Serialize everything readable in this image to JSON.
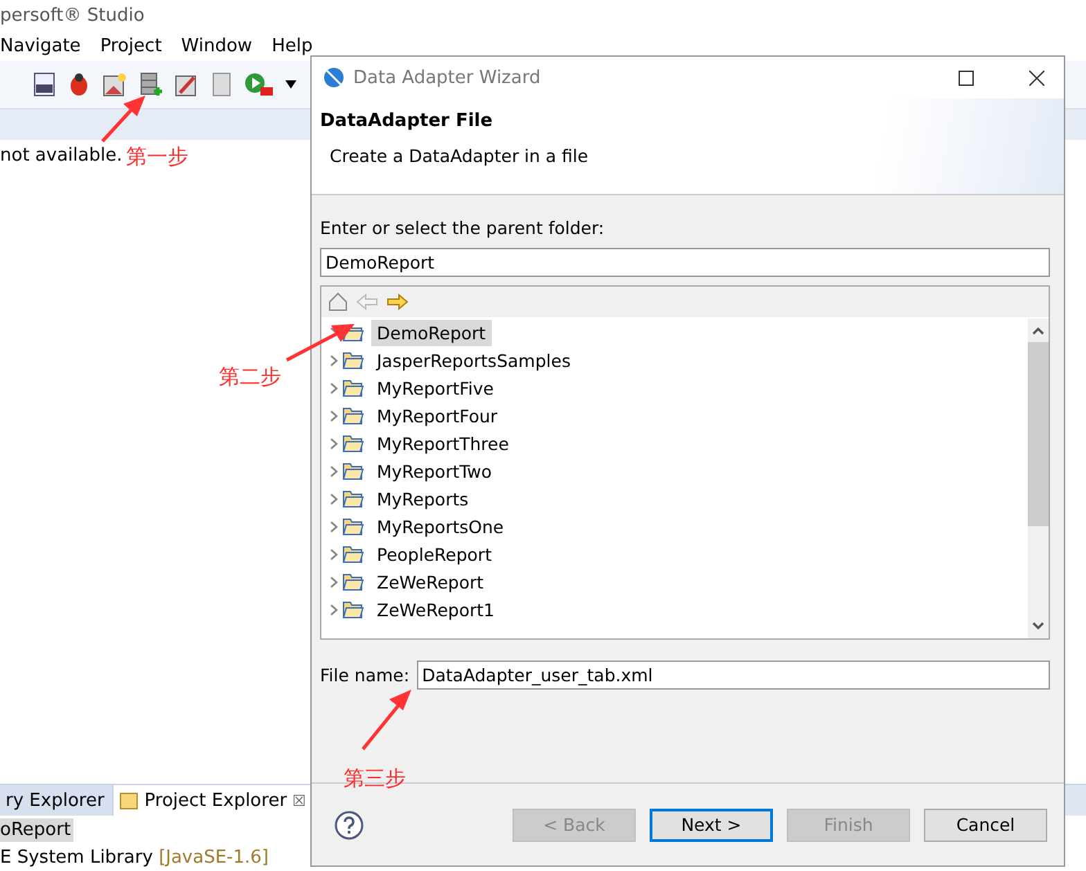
{
  "ide": {
    "title": "persoft® Studio",
    "menu": [
      "Navigate",
      "Project",
      "Window",
      "Help"
    ],
    "message": "not available.",
    "bottom_tabs": [
      {
        "label": "ry Explorer",
        "selected": false
      },
      {
        "label": "Project Explorer",
        "selected": true,
        "close": "☒"
      }
    ],
    "tree": [
      {
        "label": "oReport",
        "selected": true
      },
      {
        "label": "E System Library",
        "suffix": "[JavaSE-1.6]",
        "selected": false
      }
    ]
  },
  "dialog": {
    "title": "Data Adapter Wizard",
    "heading": "DataAdapter File",
    "description": "Create a DataAdapter in a file",
    "folder_label": "Enter or select the parent folder:",
    "folder_value": "DemoReport",
    "folders": [
      {
        "label": "DemoReport",
        "selected": true
      },
      {
        "label": "JasperReportsSamples",
        "selected": false
      },
      {
        "label": "MyReportFive",
        "selected": false
      },
      {
        "label": "MyReportFour",
        "selected": false
      },
      {
        "label": "MyReportThree",
        "selected": false
      },
      {
        "label": "MyReportTwo",
        "selected": false
      },
      {
        "label": "MyReports",
        "selected": false
      },
      {
        "label": "MyReportsOne",
        "selected": false
      },
      {
        "label": "PeopleReport",
        "selected": false
      },
      {
        "label": "ZeWeReport",
        "selected": false
      },
      {
        "label": "ZeWeReport1",
        "selected": false
      }
    ],
    "file_label": "File name:",
    "file_value": "DataAdapter_user_tab.xml",
    "buttons": [
      {
        "label": "< Back",
        "disabled": true,
        "default": false
      },
      {
        "label": "Next >",
        "disabled": false,
        "default": true
      },
      {
        "label": "Finish",
        "disabled": true,
        "default": false
      },
      {
        "label": "Cancel",
        "disabled": false,
        "default": false
      }
    ]
  },
  "annotations": [
    "第一步",
    "第二步",
    "第三步"
  ]
}
